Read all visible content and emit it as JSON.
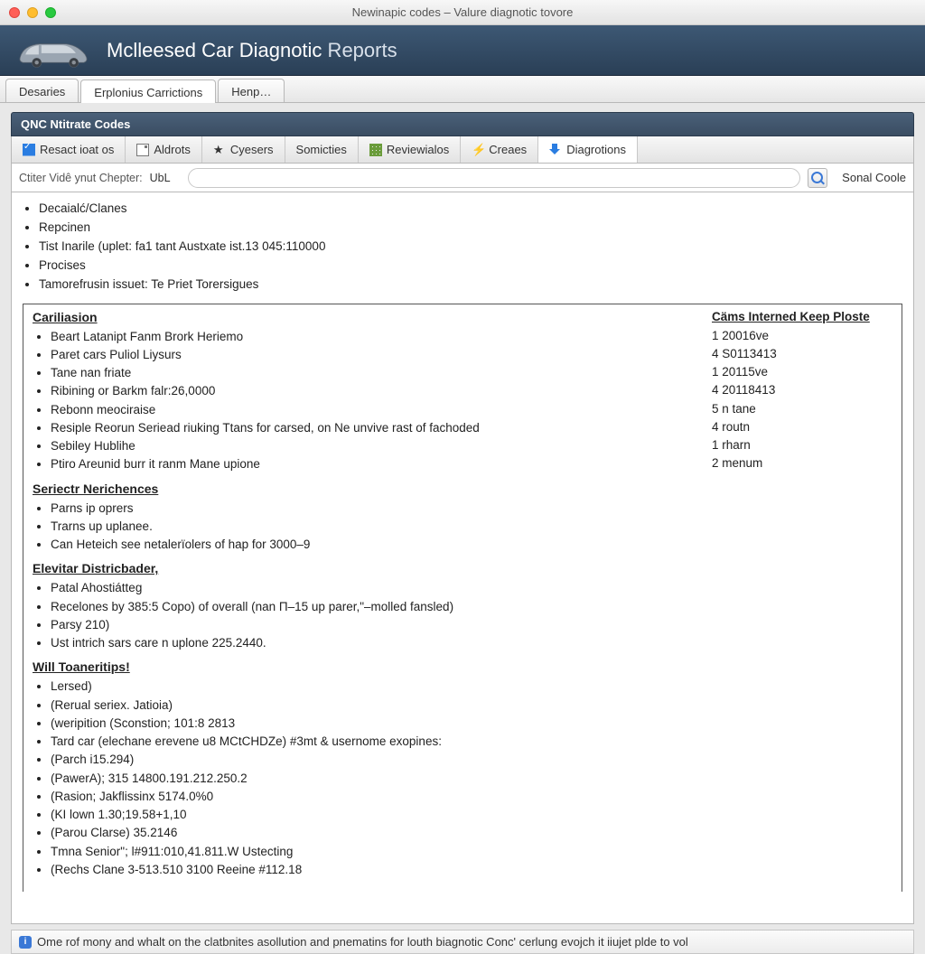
{
  "window": {
    "title": "Newinapic codes – Valure diagnotic tovore"
  },
  "header": {
    "app_title_bold": "Mclleesed Car Diagnotic",
    "app_title_light": " Reports"
  },
  "primary_tabs": [
    {
      "label": "Desaries"
    },
    {
      "label": "Erplonius Carrictions"
    },
    {
      "label": "Henp…"
    }
  ],
  "panel": {
    "title": "QNC Ntitrate Codes"
  },
  "toolbar": [
    {
      "icon": "check",
      "label": "Resact ioat os"
    },
    {
      "icon": "doc",
      "label": "Aldrots"
    },
    {
      "icon": "star",
      "label": "Cyesers"
    },
    {
      "icon": "",
      "label": "Somicties"
    },
    {
      "icon": "grid",
      "label": "Reviewialos"
    },
    {
      "icon": "bolt",
      "label": "Creaes"
    },
    {
      "icon": "down",
      "label": "Diagrotions"
    }
  ],
  "search": {
    "filter_label": "Ctiter Vidê ynut Chepter:",
    "ubl": "UbL",
    "placeholder": "",
    "sonal": "Sonal Coole"
  },
  "top_items": [
    "Decaialć/Clanes",
    "Repcinen",
    "Tist Inarile (uplet: fa1 tant Austxate ist.13 045:110000",
    "Procises",
    "Tamorefrusin issuet: Te Priet Torersigues"
  ],
  "sections": [
    {
      "title": "Cariliasion",
      "items": [
        "Beart Latanipt Fanm Brork Heriemo",
        "Paret cars Puliol Liysurs",
        "Tane nan friate",
        "Ribining or Barkm falr:26,0000",
        "Rebonn meociraise",
        "Resiple Reorun Seriead riuking Ttans for carsed, on Ne unvive rast of fachoded",
        "Sebiley Hublihe",
        "Ptiro Areunid burr it ranm Mane upione"
      ],
      "right_header": "Cäms Interned Keep Ploste",
      "right_values": [
        "1 20016ve",
        "4 S0113413",
        "1 20115ve",
        "4 20118413",
        "5 n tane",
        "4 routn",
        "1 rharn",
        "2 menum"
      ]
    },
    {
      "title": "Seriectr Nerichences",
      "items": [
        "Parns ip oprers",
        "Trarns up uplanee.",
        "Can Heteich see netalerïolers of hap for 3000–9"
      ]
    },
    {
      "title": "Elevitar Districbader,",
      "items": [
        "Patal Ahostiátteg",
        "Recelones by 385:5 Copo) of overall (nan Π–15 up parer,\"–molled fansled)",
        "Parsy 210)",
        "Ust intrich sars care n uplone 225.2440."
      ]
    },
    {
      "title": "Will Toaneritips!",
      "items": [
        "Lersed)",
        "(Rerual seriex. Jatioia)",
        "(weripition (Sconstion; 101:8 2813",
        "Tard car (elechane erevene u8 MCtCHDZe) #3mt & usernome exopines:",
        "(Parch i15.294)",
        "(PawerA); 315 14800.191.212.250.2",
        "(Rasion; Jakflissinx 5174.0%0",
        "(KI lown 1.30;19.58+1,10",
        "(Parou Clarse) 35.2146",
        "Tmna Senior\"; l#911:010,41.811.W Ustecting",
        "(Rechs Clane 3-513.510 3100 Reeine #112.18"
      ]
    }
  ],
  "status": {
    "text": "Ome rof mony and whalt on the clatbnites asollution and pnematins for louth biagnotic Conc' cerlung evojch it iiujet plde to vol"
  }
}
